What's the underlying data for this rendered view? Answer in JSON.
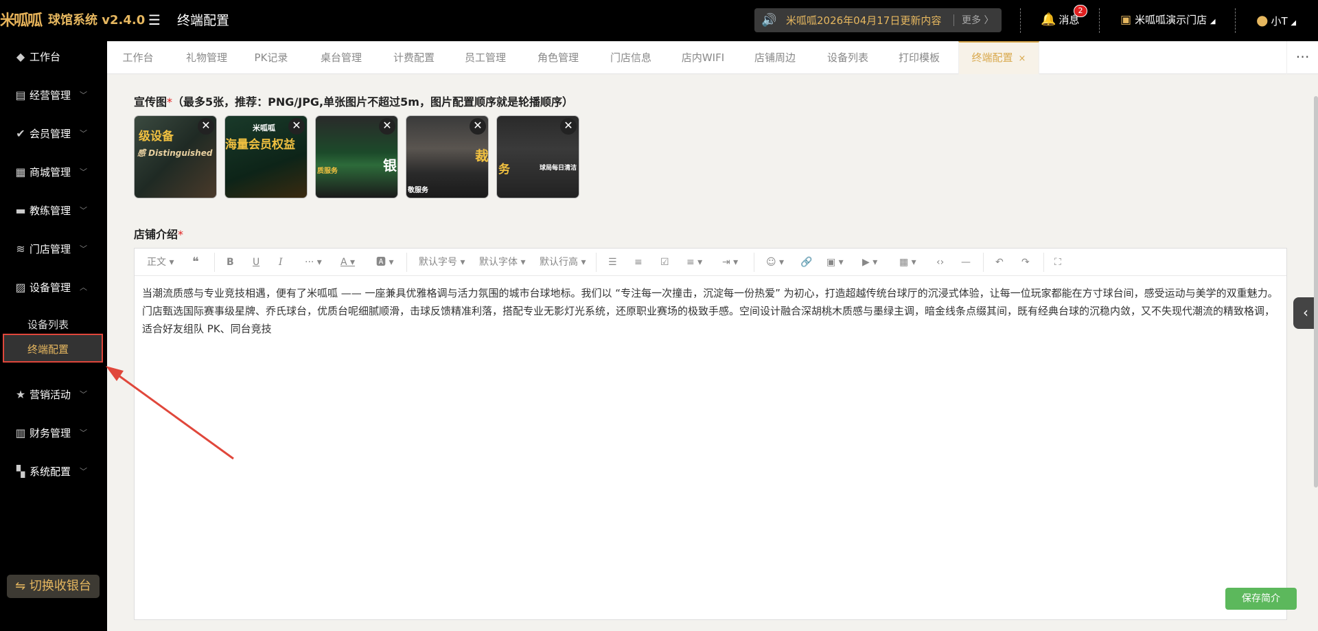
{
  "header": {
    "logo_text": "米呱呱",
    "system_name": "球馆系统 v2.4.0",
    "page_title": "终端配置",
    "notice_text": "米呱呱2026年04月17日更新内容",
    "notice_more": "更多 〉",
    "messages_label": "消息",
    "messages_count": "2",
    "store_name": "米呱呱演示门店",
    "user_name": "小T"
  },
  "sidebar": {
    "items": [
      {
        "label": "工作台",
        "icon": "cube-icon"
      },
      {
        "label": "经营管理",
        "icon": "chart-icon"
      },
      {
        "label": "会员管理",
        "icon": "check-icon"
      },
      {
        "label": "商城管理",
        "icon": "shop-icon"
      },
      {
        "label": "教练管理",
        "icon": "coach-icon"
      },
      {
        "label": "门店管理",
        "icon": "coins-icon"
      },
      {
        "label": "设备管理",
        "icon": "device-icon"
      },
      {
        "label": "营销活动",
        "icon": "star-icon"
      },
      {
        "label": "财务管理",
        "icon": "finance-icon"
      },
      {
        "label": "系统配置",
        "icon": "grid-icon"
      }
    ],
    "sub_items": [
      "设备列表",
      "终端配置"
    ],
    "switch_label": "⇋ 切换收银台"
  },
  "tabs": [
    "工作台",
    "礼物管理",
    "PK记录",
    "桌台管理",
    "计费配置",
    "员工管理",
    "角色管理",
    "门店信息",
    "店内WIFI",
    "店铺周边",
    "设备列表",
    "打印模板",
    "终端配置"
  ],
  "tabs_close": "×",
  "promo": {
    "label": "宣传图",
    "required_mark": "*",
    "hint": "（最多5张，推荐：PNG/JPG,单张图片不超过5m，图片配置顺序就是轮播顺序）",
    "images": [
      {
        "text": "级设备",
        "sub": "感 Distinguished"
      },
      {
        "text": "海量会员权益",
        "sub": "米呱呱"
      },
      {
        "text": "银",
        "sub": "质服务"
      },
      {
        "text": "裁",
        "sub": "敬服务"
      },
      {
        "text": "务",
        "sub": "球局每日清洁"
      }
    ]
  },
  "intro": {
    "label": "店铺介绍",
    "required_mark": "*",
    "toolbar": {
      "paragraph": "正文",
      "font_size": "默认字号",
      "font_family": "默认字体",
      "line_height": "默认行高"
    },
    "paragraph_1": "当潮流质感与专业竞技相遇，便有了米呱呱 —— 一座兼具优雅格调与活力氛围的城市台球地标。我们以 “专注每一次撞击，沉淀每一份热爱” 为初心，打造超越传统台球厅的沉浸式体验，让每一位玩家都能在方寸球台间，感受运动与美学的双重魅力。",
    "paragraph_2": "门店甄选国际赛事级星牌、乔氏球台，优质台呢细腻顺滑，击球反馈精准利落，搭配专业无影灯光系统，还原职业赛场的极致手感。空间设计融合深胡桃木质感与墨绿主调，暗金线条点缀其间，既有经典台球的沉稳内敛，又不失现代潮流的精致格调，适合好友组队 PK、同台竞技"
  },
  "save_label": "保存简介",
  "colors": {
    "accent": "#e6b75f",
    "save_green": "#5cb85c",
    "highlight_red": "#e0473b"
  }
}
